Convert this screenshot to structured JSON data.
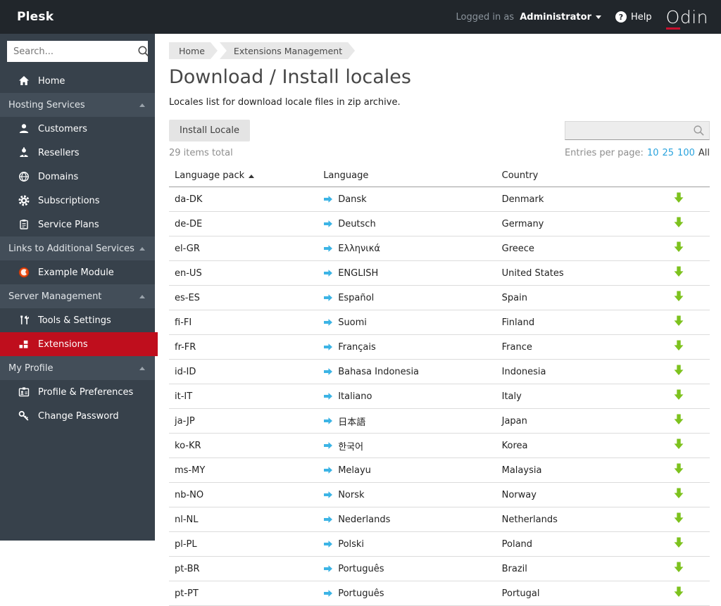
{
  "topbar": {
    "brand": "Plesk",
    "logged_in_label": "Logged in as",
    "user": "Administrator",
    "help_label": "Help",
    "logo_first": "O",
    "logo_rest": "din"
  },
  "sidebar": {
    "search_placeholder": "Search...",
    "nav": [
      {
        "type": "item",
        "icon": "home-icon",
        "label": "Home"
      },
      {
        "type": "header",
        "label": "Hosting Services"
      },
      {
        "type": "item",
        "icon": "customers-icon",
        "label": "Customers"
      },
      {
        "type": "item",
        "icon": "resellers-icon",
        "label": "Resellers"
      },
      {
        "type": "item",
        "icon": "domains-icon",
        "label": "Domains"
      },
      {
        "type": "item",
        "icon": "subscriptions-icon",
        "label": "Subscriptions"
      },
      {
        "type": "item",
        "icon": "service-plans-icon",
        "label": "Service Plans"
      },
      {
        "type": "header",
        "label": "Links to Additional Services"
      },
      {
        "type": "item",
        "icon": "example-module-icon",
        "label": "Example Module"
      },
      {
        "type": "header",
        "label": "Server Management"
      },
      {
        "type": "item",
        "icon": "tools-settings-icon",
        "label": "Tools & Settings"
      },
      {
        "type": "item",
        "icon": "extensions-icon",
        "label": "Extensions",
        "active": true
      },
      {
        "type": "header",
        "label": "My Profile"
      },
      {
        "type": "item",
        "icon": "profile-preferences-icon",
        "label": "Profile & Preferences"
      },
      {
        "type": "item",
        "icon": "change-password-icon",
        "label": "Change Password"
      }
    ]
  },
  "breadcrumb": [
    "Home",
    "Extensions Management"
  ],
  "page": {
    "title": "Download / Install locales",
    "description": "Locales list for download locale files in zip archive."
  },
  "toolbar": {
    "install_button": "Install Locale",
    "search_value": ""
  },
  "list_info": {
    "items_total": "29 items total",
    "entries_label": "Entries per page:",
    "options": [
      "10",
      "25",
      "100",
      "All"
    ],
    "active_option": "All"
  },
  "table": {
    "headers": [
      "Language pack",
      "Language",
      "Country"
    ],
    "sorted_by": "Language pack",
    "sort_direction": "ascending",
    "rows": [
      {
        "pack": "da-DK",
        "language": "Dansk",
        "country": "Denmark"
      },
      {
        "pack": "de-DE",
        "language": "Deutsch",
        "country": "Germany"
      },
      {
        "pack": "el-GR",
        "language": "Ελληνικά",
        "country": "Greece"
      },
      {
        "pack": "en-US",
        "language": "ENGLISH",
        "country": "United States"
      },
      {
        "pack": "es-ES",
        "language": "Español",
        "country": "Spain"
      },
      {
        "pack": "fi-FI",
        "language": "Suomi",
        "country": "Finland"
      },
      {
        "pack": "fr-FR",
        "language": "Français",
        "country": "France"
      },
      {
        "pack": "id-ID",
        "language": "Bahasa Indonesia",
        "country": "Indonesia"
      },
      {
        "pack": "it-IT",
        "language": "Italiano",
        "country": "Italy"
      },
      {
        "pack": "ja-JP",
        "language": "日本語",
        "country": "Japan"
      },
      {
        "pack": "ko-KR",
        "language": "한국어",
        "country": "Korea"
      },
      {
        "pack": "ms-MY",
        "language": "Melayu",
        "country": "Malaysia"
      },
      {
        "pack": "nb-NO",
        "language": "Norsk",
        "country": "Norway"
      },
      {
        "pack": "nl-NL",
        "language": "Nederlands",
        "country": "Netherlands"
      },
      {
        "pack": "pl-PL",
        "language": "Polski",
        "country": "Poland"
      },
      {
        "pack": "pt-BR",
        "language": "Português",
        "country": "Brazil"
      },
      {
        "pack": "pt-PT",
        "language": "Português",
        "country": "Portugal"
      }
    ]
  },
  "colors": {
    "topbar_bg": "#21262b",
    "sidebar_bg": "#37414b",
    "sidebar_header_bg": "#434e59",
    "active_item_red": "#bf0e1d",
    "link_blue": "#2aa3dd",
    "language_arrow_blue": "#3cb4e5",
    "download_green": "#7dc21e",
    "odin_underline_red": "#c8102e"
  }
}
